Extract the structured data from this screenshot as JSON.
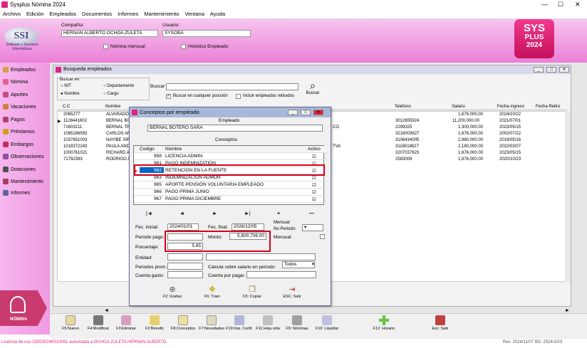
{
  "app": {
    "title": "Sysplus Nómina 2024"
  },
  "menu": [
    "Archivo",
    "Edición",
    "Empleados",
    "Documentos",
    "Informes",
    "Mantenimiento",
    "Ventana",
    "Ayuda"
  ],
  "header": {
    "compania_label": "Compañía:",
    "compania_value": "HERNAN ALBERTO OCHOA ZULETA",
    "usuario_label": "Usuario:",
    "usuario_value": "SYSOBA",
    "nomina_mensual": "Nómina mensual",
    "historico": "Histórico Empleado",
    "logo_text": "SSI",
    "logo_sub": "Software y Servicios Informáticos",
    "badge_line1": "SYS",
    "badge_line2": "PLUS",
    "badge_line3": "2024"
  },
  "sidebar": [
    "Empleados",
    "Nómina",
    "Aportes",
    "Vacaciones",
    "Pagos",
    "Préstamos",
    "Embargos",
    "Observaciones",
    "Dotaciones",
    "Mantenimiento",
    "Informes"
  ],
  "sidebar_tile": "NÓMINA",
  "busqueda": {
    "title": "Busqueda empleados",
    "buscar_en": "Buscar en:",
    "opt_nit": "NIT",
    "opt_nombre": "Nombre",
    "opt_depto": "Departamento",
    "opt_cargo": "Cargo",
    "buscar_label": "Buscar",
    "chk_cualquier": "Buscar en cualquier posición",
    "chk_retirados": "Incluir empleados retirados",
    "buscar_btn": "Buscar",
    "cols": [
      "C.C",
      "Nombre",
      "Telefono",
      "Salario",
      "Fecha ingreso",
      "Fecha Retiro"
    ],
    "rows": [
      [
        "2065277",
        "ALVARADO",
        "",
        "1,676,000.00",
        "2024/10/22"
      ],
      [
        "1128441602",
        "BERNAL BO",
        "3012655924",
        "11,200,000.00",
        "2021/07/01"
      ],
      [
        "71603211",
        "BERNAL TR",
        "2299325",
        "1,300,000.00",
        "2023/05/15"
      ],
      [
        "1085166593",
        "CARLOS AN",
        "3216003627",
        "1,676,000.00",
        "2002/07/22"
      ],
      [
        "1037651003",
        "NAYIBE SIR",
        "3106434005",
        "2,980,000.00",
        "2019/05/16"
      ],
      [
        "1018372243",
        "PAULA AND",
        "3116018827",
        "2,180,000.00",
        "2022/03/07"
      ],
      [
        "1000761021",
        "RICHARD A",
        "3207037623",
        "1,676,000.00",
        "2023/05/15"
      ],
      [
        "71792393",
        "RODRIGO A",
        "2583009",
        "1,676,000.00",
        "2020/10/23"
      ]
    ],
    "mid_fragments": [
      "CO",
      "TVA"
    ]
  },
  "dialog": {
    "title": "Conceptos por empleado",
    "empleado_label": "Empleado",
    "empleado_value": "BERNAL BOTERO SARA",
    "conceptos_label": "Conceptos",
    "col_codigo": "Codigo",
    "col_nombre": "Nombre",
    "col_activo": "Activo",
    "rows": [
      {
        "code": "958",
        "name": "LICENCIA ADMIN",
        "checked": true
      },
      {
        "code": "961",
        "name": "PAGO INDEMNIZATION",
        "checked": true
      },
      {
        "code": "962",
        "name": "RETENCION EN LA FUENTE",
        "checked": true,
        "selected": true
      },
      {
        "code": "963",
        "name": "INDEMNIZACION ADMON",
        "checked": true
      },
      {
        "code": "965",
        "name": "APORTE PENSIÓN VOLUNTARIA EMPLEADO",
        "checked": true
      },
      {
        "code": "966",
        "name": "PAGO PRIMA JUNIO",
        "checked": true
      },
      {
        "code": "967",
        "name": "PAGO PRIMA DICIEMBRE",
        "checked": true
      }
    ],
    "nav": [
      "|◄",
      "◄",
      "►",
      "►|",
      "+",
      "—"
    ],
    "fec_inicial_label": "Fec. inicial:",
    "fec_inicial": "2024/01/01",
    "fec_final_label": "Fec. final:",
    "fec_final": "2026/12/05",
    "mensual_label": "Mensual",
    "no_periodo": "No Periodo:",
    "periodo_pago": "Periodo pago:",
    "monto_label": "Monto:",
    "monto": "5,600,706.00",
    "mensual_chk": "Mensual",
    "porcentaje_label": "Porcentaje:",
    "porcentaje": "5.65",
    "entidad": "Entidad:",
    "periodos_prom": "Periodos prom.:",
    "calcula": "Calcula sobre salario en periodo:",
    "todos": "Todos",
    "cuenta_gasto": "Cuenta gasto:",
    "cuenta_pagar": "Cuenta por pagar:",
    "buttons": [
      "F2: Grabar",
      "F6: Traer",
      "F5: Copiar",
      "ESC: Salir"
    ]
  },
  "toolbar": [
    "F5:Nuevo",
    "F4:Modificar",
    "F3:Eliminar",
    "F2:Benefic",
    "F8:Conceptos",
    "F7:Novedades",
    "F10:Imp. Certif.",
    "F11:Hoja vida",
    "F9: Nóminas",
    "F10: Liquidar",
    "F12: Horario",
    "Esc: Salir"
  ],
  "status": {
    "left": "Licencia de uso 020020240510091 autorizada a OCHOA ZULETA HERNAN ALBERTO",
    "right": "Rev. 2024/11/07 BD: 2024/10/3"
  }
}
